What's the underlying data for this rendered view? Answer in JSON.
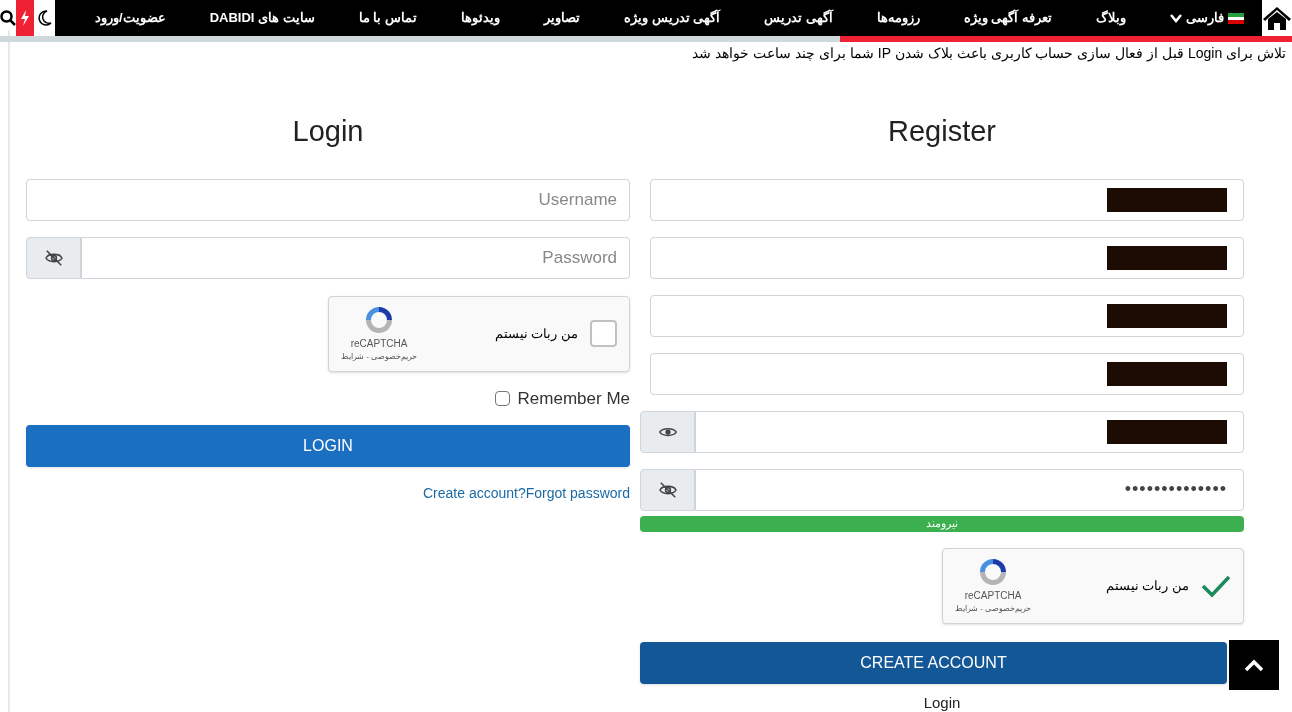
{
  "nav": {
    "items": [
      "فارسی",
      "وبلاگ",
      "تعرفه آگهی ویژه",
      "رزومه‌ها",
      "آگهی تدریس",
      "آگهی تدریس ویژه",
      "تصاویر",
      "ویدئوها",
      "تماس با ما",
      "سایت های DABIDI",
      "عضویت/ورود"
    ]
  },
  "scroll_progress": {
    "level": 0.35
  },
  "notice": "تلاش برای Login قبل از فعال سازی حساب کاربری باعث بلاک شدن IP شما برای چند ساعت خواهد شد",
  "login": {
    "title": "Login",
    "fields": [
      {
        "kind": "text",
        "placeholder": "Username"
      },
      {
        "kind": "password",
        "placeholder": "Password",
        "revealed": false
      }
    ],
    "captcha": {
      "label": "من ربات نیستم",
      "brand": "reCAPTCHA",
      "links": "حریم‌خصوصی - شرایط",
      "checked": false
    },
    "remember": {
      "label": "Remember Me",
      "checked": false
    },
    "button": "LOGIN",
    "links": [
      "Forgot password",
      "Create account?"
    ]
  },
  "register": {
    "title": "Register",
    "fields": [
      {
        "kind": "redacted"
      },
      {
        "kind": "redacted"
      },
      {
        "kind": "redacted"
      },
      {
        "kind": "redacted"
      },
      {
        "kind": "redacted",
        "revealed": true
      },
      {
        "kind": "password",
        "value": "••••••••••••••",
        "revealed": false
      }
    ],
    "strength": {
      "label": "نیرومند",
      "level": 1
    },
    "captcha": {
      "label": "من ربات نیستم",
      "brand": "reCAPTCHA",
      "links": "حریم‌خصوصی - شرایط",
      "checked": true
    },
    "button": "CREATE ACCOUNT",
    "link": "Login"
  }
}
